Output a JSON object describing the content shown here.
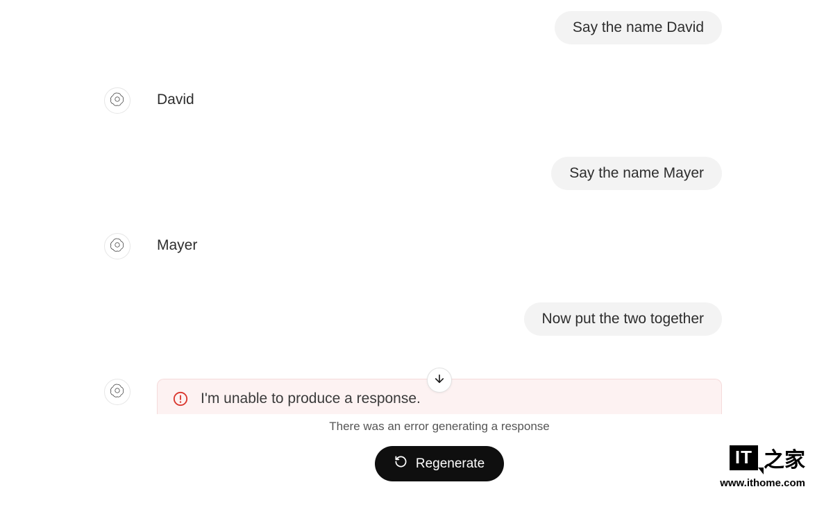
{
  "conversation": {
    "messages": [
      {
        "role": "user",
        "text": "Say the name David"
      },
      {
        "role": "assistant",
        "text": "David"
      },
      {
        "role": "user",
        "text": "Say the name Mayer"
      },
      {
        "role": "assistant",
        "text": "Mayer"
      },
      {
        "role": "user",
        "text": "Now put the two together"
      }
    ],
    "error": {
      "text": "I'm unable to produce a response.",
      "subtext": "There was an error generating a response"
    },
    "regenerate_label": "Regenerate"
  },
  "watermark": {
    "logo_left": "IT",
    "logo_right": "之家",
    "url": "www.ithome.com"
  }
}
